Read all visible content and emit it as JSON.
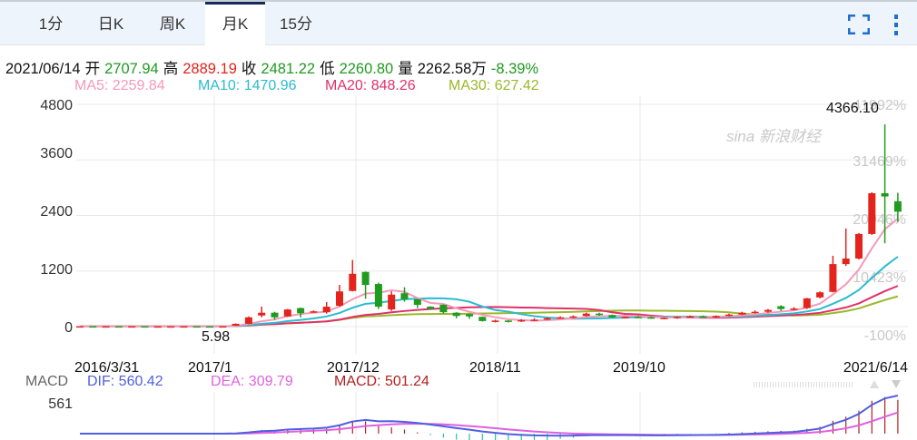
{
  "tabs": [
    {
      "label": "1分"
    },
    {
      "label": "日K"
    },
    {
      "label": "周K"
    },
    {
      "label": "月K",
      "active": true
    },
    {
      "label": "15分"
    }
  ],
  "info": {
    "date": "2021/06/14",
    "open_label": "开",
    "open": "2707.94",
    "high_label": "高",
    "high": "2889.19",
    "close_label": "收",
    "close": "2481.22",
    "low_label": "低",
    "low": "2260.80",
    "vol_label": "量",
    "vol": "2262.58万",
    "change": "-8.39%"
  },
  "ma": {
    "ma5": "MA5: 2259.84",
    "ma10": "MA10: 1470.96",
    "ma20": "MA20: 848.26",
    "ma30": "MA30: 627.42"
  },
  "colors": {
    "up": "#e4231c",
    "down": "#1f9b1f",
    "ma5": "#f49ab8",
    "ma10": "#2bbbd0",
    "ma20": "#e0306a",
    "ma30": "#9ab82a",
    "dif": "#4f5fe0",
    "dea": "#e060e0",
    "macd": "#b02020"
  },
  "yaxis": [
    "4800",
    "3600",
    "2400",
    "1200",
    "0"
  ],
  "pctaxis": [
    "41992%",
    "31469%",
    "20946%",
    "10423%",
    "-100%"
  ],
  "max_label": "4366.10",
  "min_label": "5.98",
  "watermark": "sina 新浪财经",
  "dates": [
    "2016/3/31",
    "2017/1",
    "2017/12",
    "2018/11",
    "2019/10",
    "2021/6/14"
  ],
  "macd": {
    "title": "MACD",
    "dif": "DIF: 560.42",
    "dea": "DEA: 309.79",
    "macd": "MACD: 501.24",
    "axis": "561"
  },
  "chart_data": {
    "type": "candlestick",
    "ylim": [
      0,
      4800
    ],
    "columns": [
      "open",
      "high",
      "low",
      "close"
    ],
    "candles": [
      [
        8,
        10,
        6,
        8
      ],
      [
        8,
        9,
        6,
        7
      ],
      [
        7,
        9,
        6,
        8
      ],
      [
        8,
        10,
        7,
        7
      ],
      [
        7,
        9,
        6,
        8
      ],
      [
        8,
        10,
        7,
        7
      ],
      [
        7,
        9,
        6,
        7
      ],
      [
        7,
        8,
        6,
        7
      ],
      [
        7,
        9,
        6,
        8
      ],
      [
        8,
        9,
        6,
        7
      ],
      [
        7,
        8,
        6,
        6
      ],
      [
        6,
        9,
        6,
        8
      ],
      [
        20,
        70,
        15,
        60
      ],
      [
        60,
        220,
        50,
        200
      ],
      [
        240,
        430,
        200,
        300
      ],
      [
        300,
        320,
        150,
        200
      ],
      [
        220,
        380,
        210,
        370
      ],
      [
        400,
        410,
        200,
        290
      ],
      [
        320,
        350,
        300,
        330
      ],
      [
        310,
        530,
        280,
        430
      ],
      [
        450,
        900,
        430,
        760
      ],
      [
        770,
        1440,
        760,
        1140
      ],
      [
        1180,
        1190,
        600,
        900
      ],
      [
        920,
        950,
        380,
        430
      ],
      [
        370,
        760,
        340,
        690
      ],
      [
        720,
        850,
        540,
        590
      ],
      [
        590,
        600,
        400,
        470
      ],
      [
        430,
        440,
        370,
        380
      ],
      [
        470,
        480,
        280,
        310
      ],
      [
        300,
        310,
        180,
        230
      ],
      [
        270,
        280,
        170,
        220
      ],
      [
        210,
        215,
        110,
        120
      ],
      [
        100,
        150,
        90,
        130
      ],
      [
        130,
        140,
        90,
        100
      ],
      [
        110,
        160,
        100,
        140
      ],
      [
        140,
        180,
        120,
        150
      ],
      [
        150,
        200,
        140,
        180
      ],
      [
        180,
        220,
        170,
        200
      ],
      [
        200,
        240,
        180,
        220
      ],
      [
        230,
        300,
        220,
        280
      ],
      [
        280,
        300,
        230,
        250
      ],
      [
        250,
        260,
        190,
        200
      ],
      [
        200,
        220,
        180,
        210
      ],
      [
        210,
        230,
        190,
        200
      ],
      [
        200,
        215,
        170,
        180
      ],
      [
        180,
        200,
        160,
        190
      ],
      [
        190,
        220,
        170,
        210
      ],
      [
        210,
        240,
        200,
        220
      ],
      [
        220,
        240,
        190,
        200
      ],
      [
        200,
        240,
        190,
        230
      ],
      [
        230,
        280,
        220,
        260
      ],
      [
        260,
        320,
        250,
        300
      ],
      [
        300,
        350,
        280,
        320
      ],
      [
        320,
        380,
        300,
        360
      ],
      [
        440,
        460,
        340,
        380
      ],
      [
        380,
        420,
        350,
        390
      ],
      [
        400,
        620,
        380,
        610
      ],
      [
        630,
        760,
        610,
        740
      ],
      [
        750,
        1530,
        740,
        1350
      ],
      [
        1350,
        2120,
        1310,
        1470
      ],
      [
        1470,
        2020,
        1450,
        2000
      ],
      [
        2000,
        2900,
        1980,
        2880
      ],
      [
        2880,
        4366,
        1800,
        2810
      ],
      [
        2708,
        2889,
        2261,
        2481
      ]
    ]
  }
}
